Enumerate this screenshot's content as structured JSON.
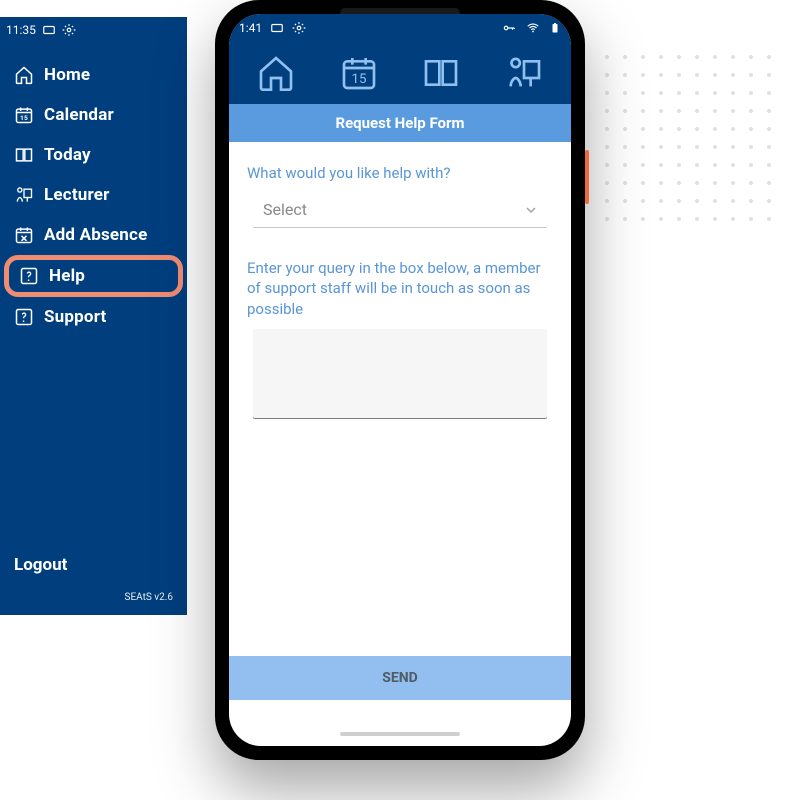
{
  "sidebar": {
    "status": {
      "time": "11:35"
    },
    "items": [
      {
        "label": "Home",
        "icon": "home-icon"
      },
      {
        "label": "Calendar",
        "icon": "calendar-icon"
      },
      {
        "label": "Today",
        "icon": "book-icon"
      },
      {
        "label": "Lecturer",
        "icon": "lecturer-icon"
      },
      {
        "label": "Add Absence",
        "icon": "calendar-x-icon"
      },
      {
        "label": "Help",
        "icon": "help-icon",
        "highlighted": true
      },
      {
        "label": "Support",
        "icon": "help-icon"
      }
    ],
    "logout_label": "Logout",
    "version": "SEAtS v2.6"
  },
  "phone": {
    "status": {
      "time": "1:41"
    },
    "tabs": [
      {
        "name": "home",
        "icon": "home-icon"
      },
      {
        "name": "calendar",
        "icon": "calendar-15-icon"
      },
      {
        "name": "today",
        "icon": "book-icon"
      },
      {
        "name": "lecturer",
        "icon": "lecturer-icon"
      }
    ],
    "banner_title": "Request Help Form",
    "form": {
      "topic_label": "What would you like help with?",
      "topic_placeholder": "Select",
      "query_label": "Enter your query in the box below, a member of support staff will be in touch as soon as possible",
      "query_value": "",
      "send_label": "SEND"
    }
  },
  "colors": {
    "brand_navy": "#003e7e",
    "accent_blue": "#5a9be0",
    "light_blue": "#93bef0",
    "highlight_coral": "#f08c72"
  }
}
